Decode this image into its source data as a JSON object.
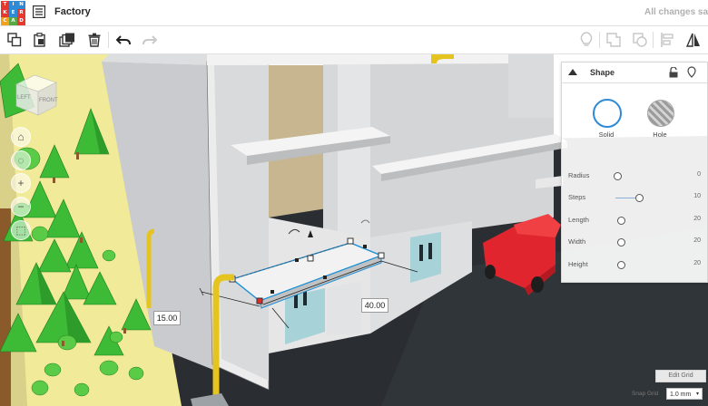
{
  "app": {
    "logo_letters": [
      "T",
      "I",
      "N",
      "K",
      "E",
      "R",
      "C",
      "A",
      "D"
    ],
    "logo_colors": [
      "#e8382e",
      "#2f8ad6",
      "#2f8ad6",
      "#e8382e",
      "#2f8ad6",
      "#e8382e",
      "#f0a21d",
      "#5aa845",
      "#e8382e"
    ],
    "design_title": "Factory",
    "save_status": "All changes saved"
  },
  "toolbar": {
    "buttons": [
      "copy-icon",
      "paste-icon",
      "duplicate-icon",
      "delete-icon",
      "undo-icon",
      "redo-icon"
    ],
    "right_buttons": [
      "lightbulb-icon",
      "group-icon",
      "ungroup-icon",
      "align-icon",
      "mirror-icon"
    ]
  },
  "viewcube": {
    "left_face": "LEFT",
    "front_face": "FRONT"
  },
  "dimensions": {
    "left": "15.00",
    "right": "40.00"
  },
  "shape_panel": {
    "title": "Shape",
    "solid_label": "Solid",
    "hole_label": "Hole",
    "properties": [
      {
        "label": "Radius",
        "value": "0",
        "knob_fraction": 0.0
      },
      {
        "label": "Steps",
        "value": "10",
        "knob_fraction": 0.3
      },
      {
        "label": "Length",
        "value": "20",
        "knob_fraction": 0.0
      },
      {
        "label": "Width",
        "value": "20",
        "knob_fraction": 0.0
      },
      {
        "label": "Height",
        "value": "20",
        "knob_fraction": 0.0
      }
    ]
  },
  "grid": {
    "edit_label": "Edit Grid",
    "snap_label": "Snap Grid",
    "snap_value": "1.0 mm"
  },
  "colors": {
    "accent": "#2f8ad6",
    "workplane": "#2b2f33",
    "grass": "#f1ec9a",
    "tree": "#3dba36",
    "building": "#cfd0d2",
    "car": "#e0252e"
  }
}
